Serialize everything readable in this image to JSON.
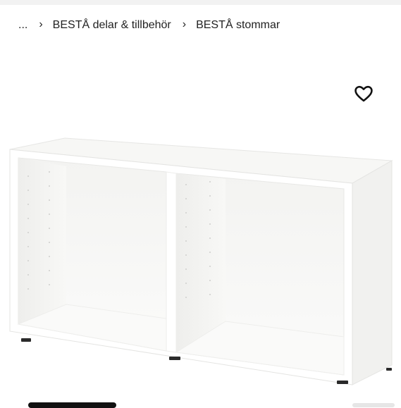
{
  "breadcrumb": {
    "ellipsis": "...",
    "items": [
      {
        "label": "BESTÅ delar & tillbehör"
      },
      {
        "label": "BESTÅ stommar"
      }
    ],
    "separator": "›"
  },
  "favorite": {
    "icon": "heart-outline-icon"
  },
  "product_image": {
    "subject": "white shelf frame",
    "color": "#ffffff"
  }
}
